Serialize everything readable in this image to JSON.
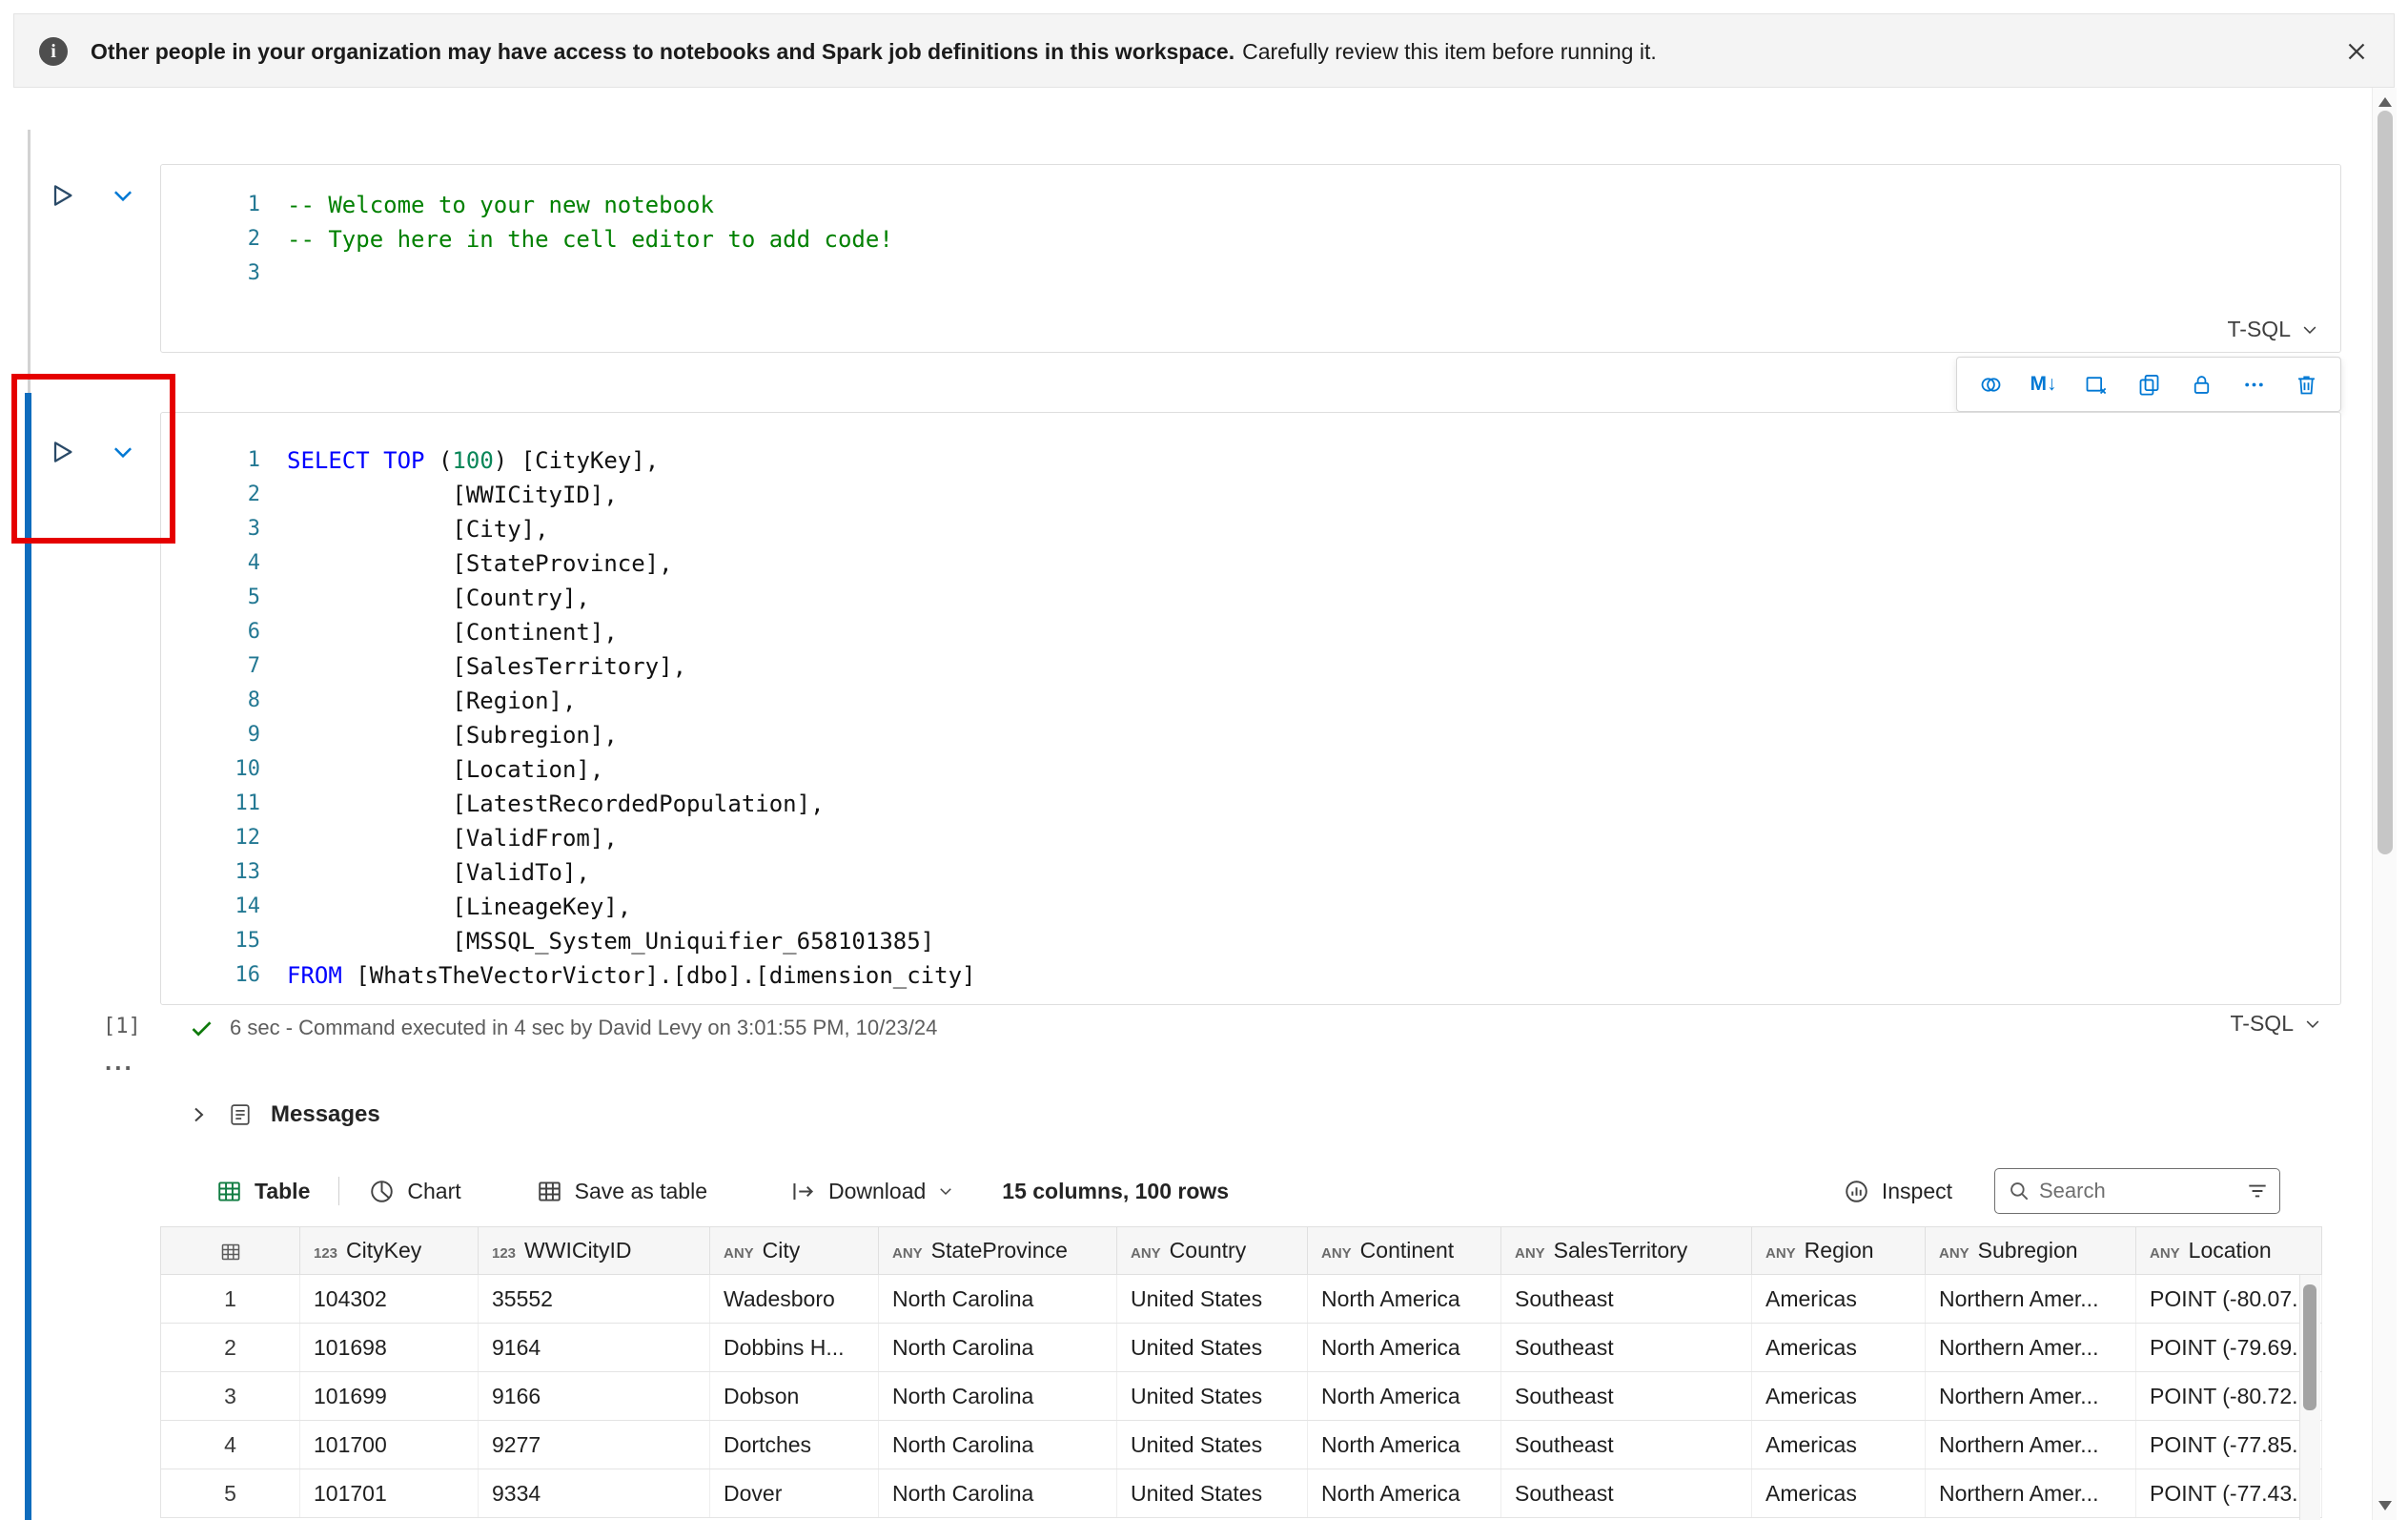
{
  "banner": {
    "bold": "Other people in your organization may have access to notebooks and Spark job definitions in this workspace.",
    "regular": "Carefully review this item before running it."
  },
  "colors": {
    "accent_blue": "#0078d4",
    "annotation_red": "#e50000",
    "active_cell_blue": "#0f6cbd",
    "keyword_blue": "#0000ff",
    "comment_green": "#008000",
    "number_green": "#098658",
    "table_icon_green": "#107c41",
    "success_green": "#0e7a0b"
  },
  "cell_toolbar": {
    "markdown_label": "M↓",
    "icons": [
      "toggle-parameters-icon",
      "markdown-icon",
      "clear-output-icon",
      "copy-cell-icon",
      "lock-cell-icon",
      "more-actions-icon",
      "delete-cell-icon"
    ]
  },
  "cells": {
    "cell1": {
      "language": "T-SQL",
      "lines": [
        {
          "n": "1",
          "tokens": [
            {
              "t": "-- Welcome to your new notebook",
              "c": "cm"
            }
          ]
        },
        {
          "n": "2",
          "tokens": [
            {
              "t": "-- Type here in the cell editor to add code!",
              "c": "cm"
            }
          ]
        },
        {
          "n": "3",
          "tokens": []
        }
      ]
    },
    "cell2": {
      "language": "T-SQL",
      "execution_label": "[1]",
      "status_text": "6 sec - Command executed in 4 sec by David Levy on 3:01:55 PM, 10/23/24",
      "collapse_dots": "...",
      "lines": [
        {
          "n": "1",
          "tokens": [
            {
              "t": "SELECT",
              "c": "kw"
            },
            {
              "t": " ",
              "c": "pl"
            },
            {
              "t": "TOP",
              "c": "kw"
            },
            {
              "t": " (",
              "c": "pl"
            },
            {
              "t": "100",
              "c": "num"
            },
            {
              "t": ") [CityKey],",
              "c": "pl"
            }
          ]
        },
        {
          "n": "2",
          "tokens": [
            {
              "t": "            [WWICityID],",
              "c": "pl"
            }
          ]
        },
        {
          "n": "3",
          "tokens": [
            {
              "t": "            [City],",
              "c": "pl"
            }
          ]
        },
        {
          "n": "4",
          "tokens": [
            {
              "t": "            [StateProvince],",
              "c": "pl"
            }
          ]
        },
        {
          "n": "5",
          "tokens": [
            {
              "t": "            [Country],",
              "c": "pl"
            }
          ]
        },
        {
          "n": "6",
          "tokens": [
            {
              "t": "            [Continent],",
              "c": "pl"
            }
          ]
        },
        {
          "n": "7",
          "tokens": [
            {
              "t": "            [SalesTerritory],",
              "c": "pl"
            }
          ]
        },
        {
          "n": "8",
          "tokens": [
            {
              "t": "            [Region],",
              "c": "pl"
            }
          ]
        },
        {
          "n": "9",
          "tokens": [
            {
              "t": "            [Subregion],",
              "c": "pl"
            }
          ]
        },
        {
          "n": "10",
          "tokens": [
            {
              "t": "            [Location],",
              "c": "pl"
            }
          ]
        },
        {
          "n": "11",
          "tokens": [
            {
              "t": "            [LatestRecordedPopulation],",
              "c": "pl"
            }
          ]
        },
        {
          "n": "12",
          "tokens": [
            {
              "t": "            [ValidFrom],",
              "c": "pl"
            }
          ]
        },
        {
          "n": "13",
          "tokens": [
            {
              "t": "            [ValidTo],",
              "c": "pl"
            }
          ]
        },
        {
          "n": "14",
          "tokens": [
            {
              "t": "            [LineageKey],",
              "c": "pl"
            }
          ]
        },
        {
          "n": "15",
          "tokens": [
            {
              "t": "            [MSSQL_System_Uniquifier_658101385]",
              "c": "pl"
            }
          ]
        },
        {
          "n": "16",
          "tokens": [
            {
              "t": "FROM",
              "c": "kw"
            },
            {
              "t": " [WhatsTheVectorVictor].[dbo].[dimension_city]",
              "c": "pl"
            }
          ]
        }
      ]
    }
  },
  "messages": {
    "label": "Messages"
  },
  "results": {
    "tabs": {
      "table": "Table",
      "chart": "Chart",
      "save_as_table": "Save as table",
      "download": "Download"
    },
    "summary": "15 columns, 100 rows",
    "inspect": "Inspect",
    "search_placeholder": "Search"
  },
  "grid": {
    "columns": [
      {
        "type": "",
        "label": ""
      },
      {
        "type": "123",
        "label": "CityKey"
      },
      {
        "type": "123",
        "label": "WWICityID"
      },
      {
        "type": "ANY",
        "label": "City"
      },
      {
        "type": "ANY",
        "label": "StateProvince"
      },
      {
        "type": "ANY",
        "label": "Country"
      },
      {
        "type": "ANY",
        "label": "Continent"
      },
      {
        "type": "ANY",
        "label": "SalesTerritory"
      },
      {
        "type": "ANY",
        "label": "Region"
      },
      {
        "type": "ANY",
        "label": "Subregion"
      },
      {
        "type": "ANY",
        "label": "Location"
      }
    ],
    "rows": [
      {
        "num": "1",
        "cells": [
          "104302",
          "35552",
          "Wadesboro",
          "North Carolina",
          "United States",
          "North America",
          "Southeast",
          "Americas",
          "Northern Amer...",
          "POINT (-80.07."
        ]
      },
      {
        "num": "2",
        "cells": [
          "101698",
          "9164",
          "Dobbins H...",
          "North Carolina",
          "United States",
          "North America",
          "Southeast",
          "Americas",
          "Northern Amer...",
          "POINT (-79.69."
        ]
      },
      {
        "num": "3",
        "cells": [
          "101699",
          "9166",
          "Dobson",
          "North Carolina",
          "United States",
          "North America",
          "Southeast",
          "Americas",
          "Northern Amer...",
          "POINT (-80.72."
        ]
      },
      {
        "num": "4",
        "cells": [
          "101700",
          "9277",
          "Dortches",
          "North Carolina",
          "United States",
          "North America",
          "Southeast",
          "Americas",
          "Northern Amer...",
          "POINT (-77.85."
        ]
      },
      {
        "num": "5",
        "cells": [
          "101701",
          "9334",
          "Dover",
          "North Carolina",
          "United States",
          "North America",
          "Southeast",
          "Americas",
          "Northern Amer...",
          "POINT (-77.43."
        ]
      }
    ]
  }
}
